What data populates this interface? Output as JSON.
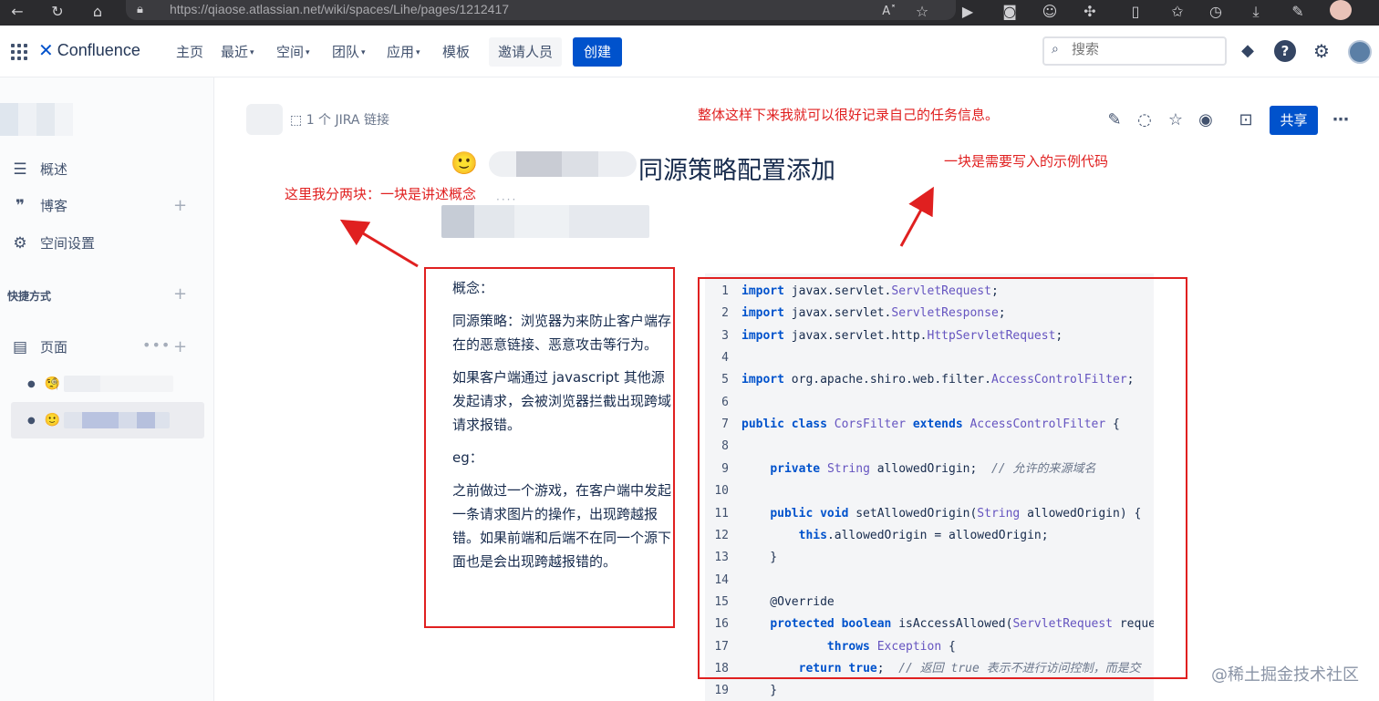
{
  "browser": {
    "url": "https://qiaose.atlassian.net/wiki/spaces/Lihe/pages/1212417"
  },
  "header": {
    "logo": "Confluence",
    "nav": [
      {
        "label": "主页",
        "dropdown": false
      },
      {
        "label": "最近",
        "dropdown": true
      },
      {
        "label": "空间",
        "dropdown": true
      },
      {
        "label": "团队",
        "dropdown": true
      },
      {
        "label": "应用",
        "dropdown": true
      },
      {
        "label": "模板",
        "dropdown": false
      }
    ],
    "invite_label": "邀请人员",
    "create_label": "创建",
    "search_placeholder": "搜索",
    "accent": "#0052cc"
  },
  "sidebar": {
    "items": [
      {
        "label": "概述",
        "icon": "overview-icon"
      },
      {
        "label": "博客",
        "icon": "quote-icon"
      },
      {
        "label": "空间设置",
        "icon": "gear-icon"
      }
    ],
    "shortcuts_label": "快捷方式",
    "pages_label": "页面",
    "tree": [
      {
        "emoji": "🧐",
        "selected": false
      },
      {
        "emoji": "🙂",
        "selected": true
      }
    ]
  },
  "page": {
    "jira_link": "1 个 JIRA 链接",
    "title": "同源策略配置添加",
    "title_emoji": "🙂",
    "share_label": "共享",
    "concept": [
      "概念：",
      "同源策略：浏览器为来防止客户端存在的恶意链接、恶意攻击等行为。",
      "如果客户端通过 javascript 其他源发起请求，会被浏览器拦截出现跨域请求报错。",
      "eg：",
      "之前做过一个游戏，在客户端中发起一条请求图片的操作，出现跨越报错。如果前端和后端不在同一个源下面也是会出现跨越报错的。"
    ]
  },
  "annotations": {
    "overall": "整体这样下来我就可以很好记录自己的任务信息。",
    "left": "这里我分两块：一块是讲述概念",
    "right": "一块是需要写入的示例代码",
    "color": "#e02020"
  },
  "code": {
    "lines": [
      [
        [
          "kw",
          "import"
        ],
        [
          "",
          " javax.servlet."
        ],
        [
          "ty",
          "ServletRequest"
        ],
        [
          "",
          ";"
        ]
      ],
      [
        [
          "kw",
          "import"
        ],
        [
          "",
          " javax.servlet."
        ],
        [
          "ty",
          "ServletResponse"
        ],
        [
          "",
          ";"
        ]
      ],
      [
        [
          "kw",
          "import"
        ],
        [
          "",
          " javax.servlet.http."
        ],
        [
          "ty",
          "HttpServletRequest"
        ],
        [
          "",
          ";"
        ]
      ],
      [],
      [
        [
          "kw",
          "import"
        ],
        [
          "",
          " org.apache.shiro.web.filter."
        ],
        [
          "ty",
          "AccessControlFilter"
        ],
        [
          "",
          ";"
        ]
      ],
      [],
      [
        [
          "kw",
          "public class"
        ],
        [
          "",
          " "
        ],
        [
          "ty",
          "CorsFilter"
        ],
        [
          "",
          " "
        ],
        [
          "kw",
          "extends"
        ],
        [
          "",
          " "
        ],
        [
          "ty",
          "AccessControlFilter"
        ],
        [
          "",
          " {"
        ]
      ],
      [],
      [
        [
          "",
          "    "
        ],
        [
          "kw",
          "private"
        ],
        [
          "",
          " "
        ],
        [
          "ty",
          "String"
        ],
        [
          "",
          " allowedOrigin;  "
        ],
        [
          "cm",
          "// 允许的来源域名"
        ]
      ],
      [],
      [
        [
          "",
          "    "
        ],
        [
          "kw",
          "public void"
        ],
        [
          "",
          " setAllowedOrigin("
        ],
        [
          "ty",
          "String"
        ],
        [
          "",
          " allowedOrigin) {"
        ]
      ],
      [
        [
          "",
          "        "
        ],
        [
          "kw",
          "this"
        ],
        [
          "",
          ".allowedOrigin = allowedOrigin;"
        ]
      ],
      [
        [
          "",
          "    }"
        ]
      ],
      [],
      [
        [
          "",
          "    @Override"
        ]
      ],
      [
        [
          "",
          "    "
        ],
        [
          "kw",
          "protected boolean"
        ],
        [
          "",
          " isAccessAllowed("
        ],
        [
          "ty",
          "ServletRequest"
        ],
        [
          "",
          " reque"
        ]
      ],
      [
        [
          "",
          "            "
        ],
        [
          "kw",
          "throws"
        ],
        [
          "",
          " "
        ],
        [
          "ty",
          "Exception"
        ],
        [
          "",
          " {"
        ]
      ],
      [
        [
          "",
          "        "
        ],
        [
          "kw",
          "return true"
        ],
        [
          "",
          ";  "
        ],
        [
          "cm",
          "// 返回 true 表示不进行访问控制，而是交"
        ]
      ],
      [
        [
          "",
          "    }"
        ]
      ]
    ]
  },
  "watermark": "@稀土掘金技术社区"
}
